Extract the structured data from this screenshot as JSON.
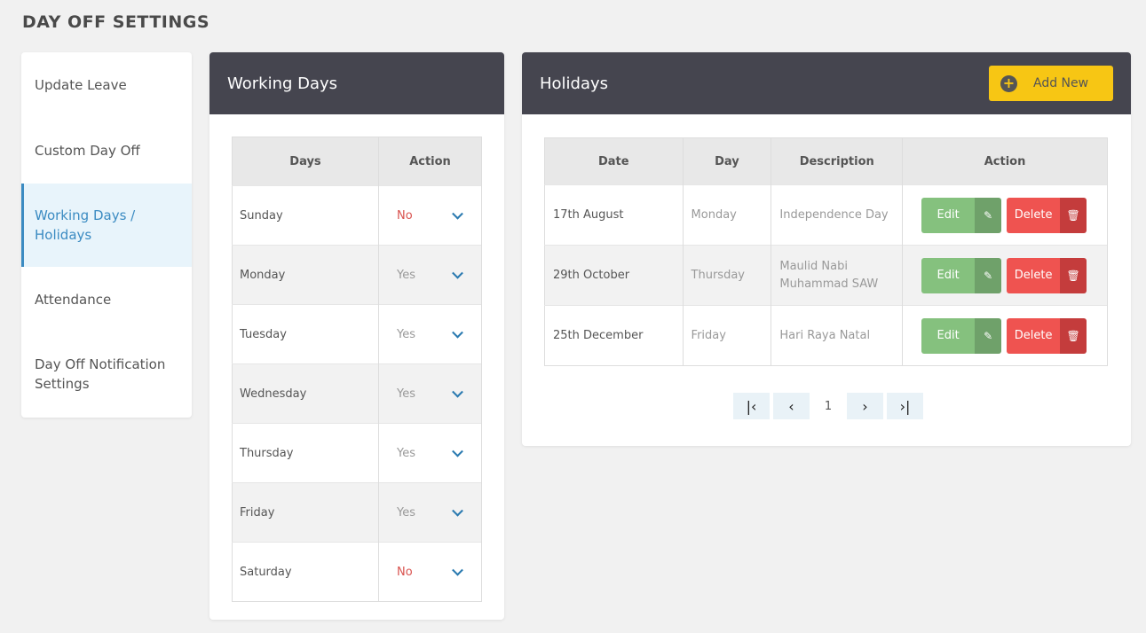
{
  "page": {
    "title": "DAY OFF SETTINGS"
  },
  "sidebar": {
    "items": [
      {
        "label": "Update Leave"
      },
      {
        "label": "Custom Day Off"
      },
      {
        "label": "Working Days / Holidays"
      },
      {
        "label": "Attendance"
      },
      {
        "label": "Day Off Notification Settings"
      }
    ],
    "active_index": 2
  },
  "working_days": {
    "title": "Working Days",
    "headers": {
      "days": "Days",
      "action": "Action"
    },
    "rows": [
      {
        "day": "Sunday",
        "value": "No"
      },
      {
        "day": "Monday",
        "value": "Yes"
      },
      {
        "day": "Tuesday",
        "value": "Yes"
      },
      {
        "day": "Wednesday",
        "value": "Yes"
      },
      {
        "day": "Thursday",
        "value": "Yes"
      },
      {
        "day": "Friday",
        "value": "Yes"
      },
      {
        "day": "Saturday",
        "value": "No"
      }
    ]
  },
  "holidays": {
    "title": "Holidays",
    "add_label": "Add New",
    "headers": {
      "date": "Date",
      "day": "Day",
      "description": "Description",
      "action": "Action"
    },
    "edit_label": "Edit",
    "delete_label": "Delete",
    "rows": [
      {
        "date": "17th August",
        "day": "Monday",
        "description": "Independence Day"
      },
      {
        "date": "29th October",
        "day": "Thursday",
        "description": "Maulid Nabi Muhammad SAW"
      },
      {
        "date": "25th December",
        "day": "Friday",
        "description": "Hari Raya Natal"
      }
    ],
    "pagination": {
      "current": "1"
    }
  },
  "colors": {
    "header": "#45454f",
    "accent": "#3b8bc2",
    "add": "#f7c614",
    "edit": "#85c17e",
    "delete": "#ef5350",
    "no": "#d9534f"
  },
  "icons": {
    "add": "plus-circle-icon",
    "edit": "pencil-icon",
    "delete": "trash-icon",
    "dropdown": "chevron-down-icon",
    "first": "first-page-icon",
    "prev": "chevron-left-icon",
    "next": "chevron-right-icon",
    "last": "last-page-icon"
  }
}
